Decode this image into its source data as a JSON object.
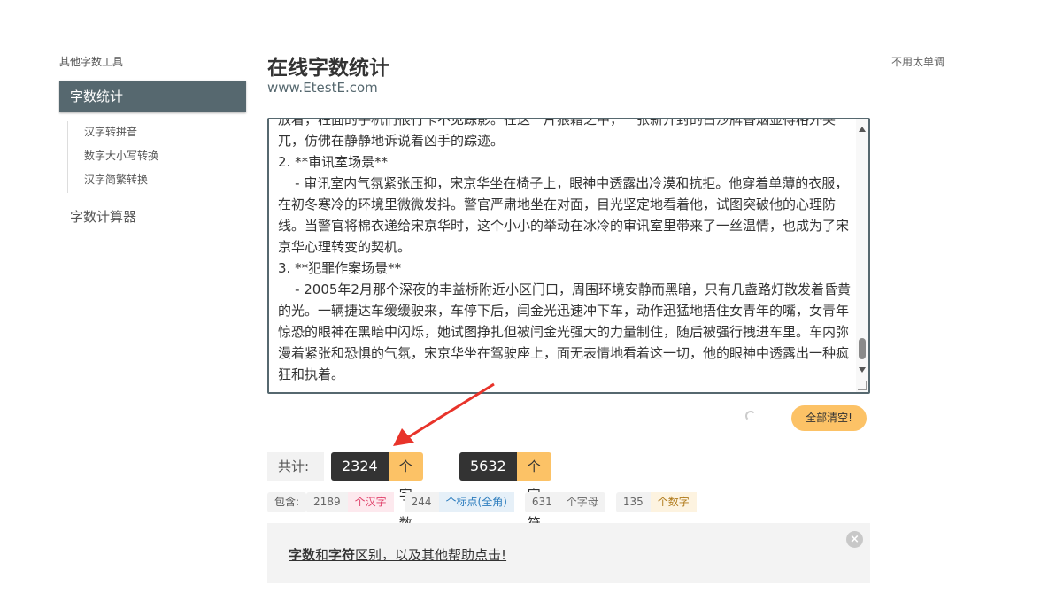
{
  "sidebar": {
    "heading": "其他字数工具",
    "active": "字数统计",
    "subitems": [
      "汉字转拼音",
      "数字大小写转换",
      "汉字简繁转换"
    ],
    "calculator": "字数计算器"
  },
  "header": {
    "title": "在线字数统计",
    "subtitle": "www.EtestE.com",
    "right_note": "不用太单调"
  },
  "editor": {
    "content": "放着，柱面的手机们很行卡不见踪影。在这一片狼藉之中，一张新开封的白沙牌香烟显得格外突兀，仿佛在静静地诉说着凶手的踪迹。\n2. **审讯室场景**\n    - 审讯室内气氛紧张压抑，宋京华坐在椅子上，眼神中透露出冷漠和抗拒。他穿着单薄的衣服，在初冬寒冷的环境里微微发抖。警官严肃地坐在对面，目光坚定地看着他，试图突破他的心理防线。当警官将棉衣递给宋京华时，这个小小的举动在冰冷的审讯室里带来了一丝温情，也成为了宋京华心理转变的契机。\n3. **犯罪作案场景**\n    - 2005年2月那个深夜的丰益桥附近小区门口，周围环境安静而黑暗，只有几盏路灯散发着昏黄的光。一辆捷达车缓缓驶来，车停下后，闫金光迅速冲下车，动作迅猛地捂住女青年的嘴，女青年惊恐的眼神在黑暗中闪烁，她试图挣扎但被闫金光强大的力量制住，随后被强行拽进车里。车内弥漫着紧张和恐惧的气氛，宋京华坐在驾驶座上，面无表情地看着这一切，他的眼神中透露出一种疯狂和执着。"
  },
  "actions": {
    "clear": "全部清空!"
  },
  "counts": {
    "total_label": "共计:",
    "words": "2324",
    "words_unit": "个字数",
    "chars": "5632",
    "chars_unit": "个字符"
  },
  "details": {
    "include_label": "包含:",
    "hanzi": "2189",
    "hanzi_unit": "个汉字",
    "punct": "244",
    "punct_unit": "个标点(全角)",
    "letters": "631",
    "letters_unit": "个字母",
    "digits": "135",
    "digits_unit": "个数字"
  },
  "help": {
    "part1": "字数",
    "part2": "和",
    "part3": "字符",
    "part4": "区别，以及其他帮助点击!",
    "close": "×"
  },
  "colors": {
    "accent": "#56686f",
    "orange": "#fcc266",
    "hanzi_unit": "#e0416a",
    "punct_unit": "#2a7bbd",
    "letters_unit": "#666666",
    "digits_unit": "#b07a1a",
    "arrow": "#e8332a"
  }
}
